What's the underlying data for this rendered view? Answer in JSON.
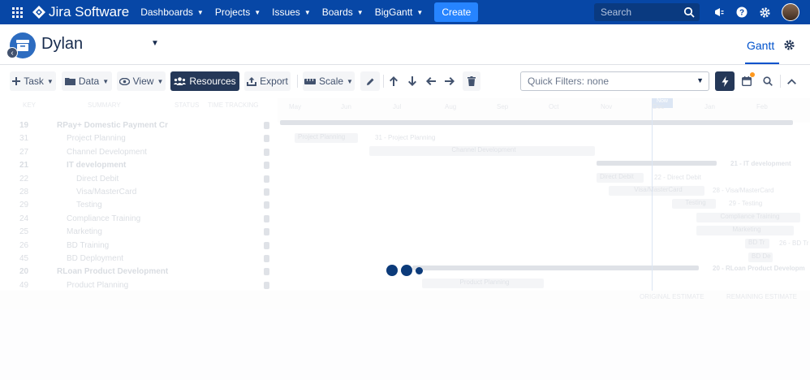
{
  "topnav": {
    "product": "Jira Software",
    "items": [
      {
        "label": "Dashboards"
      },
      {
        "label": "Projects"
      },
      {
        "label": "Issues"
      },
      {
        "label": "Boards"
      },
      {
        "label": "BigGantt"
      }
    ],
    "create_label": "Create",
    "search_placeholder": "Search"
  },
  "project": {
    "name": "Dylan",
    "active_tab": "Gantt"
  },
  "toolbar": {
    "task": "Task",
    "data": "Data",
    "view": "View",
    "resources": "Resources",
    "export": "Export",
    "scale": "Scale",
    "quick_filters": "Quick Filters: none"
  },
  "gantt": {
    "columns": [
      "KEY",
      "SUMMARY",
      "STATUS",
      "TIME TRACKING"
    ],
    "rows": [
      {
        "key": "19",
        "name": "RPay+ Domestic Payment Cr",
        "level": 0,
        "group": true
      },
      {
        "key": "31",
        "name": "Project Planning",
        "level": 1,
        "group": false
      },
      {
        "key": "27",
        "name": "Channel Development",
        "level": 1,
        "group": false
      },
      {
        "key": "21",
        "name": "IT development",
        "level": 1,
        "group": true
      },
      {
        "key": "22",
        "name": "Direct Debit",
        "level": 2,
        "group": false
      },
      {
        "key": "28",
        "name": "Visa/MasterCard",
        "level": 2,
        "group": false
      },
      {
        "key": "29",
        "name": "Testing",
        "level": 2,
        "group": false
      },
      {
        "key": "24",
        "name": "Compliance Training",
        "level": 1,
        "group": false
      },
      {
        "key": "25",
        "name": "Marketing",
        "level": 1,
        "group": false
      },
      {
        "key": "26",
        "name": "BD Training",
        "level": 1,
        "group": false
      },
      {
        "key": "45",
        "name": "BD Deployment",
        "level": 1,
        "group": false
      },
      {
        "key": "20",
        "name": "RLoan Product Development",
        "level": 0,
        "group": true
      },
      {
        "key": "49",
        "name": "Product Planning",
        "level": 1,
        "group": false
      }
    ],
    "timeline_months": [
      "May",
      "Jun",
      "Jul",
      "Aug",
      "Sep",
      "Oct",
      "Nov",
      "Dec",
      "Jan",
      "Feb"
    ],
    "today_label": "Now",
    "bar_labels": {
      "project_planning": "Project Planning",
      "project_planning_side": "31 - Project Planning",
      "channel_dev": "Channel Development",
      "it_dev_side": "21 - IT development",
      "direct_debit": "Direct Debit",
      "direct_debit_side": "22 - Direct Debit",
      "visa": "Visa/MasterCard",
      "visa_side": "28 - Visa/MasterCard",
      "testing": "Testing",
      "testing_side": "29 - Testing",
      "compliance": "Compliance Training",
      "marketing": "Marketing",
      "bd_training": "BD Tr",
      "bd_training_side": "26 - BD Tr",
      "bd_deploy": "BD De",
      "rloan_side": "20 - RLoan Product Developm",
      "product_planning": "Product Planning"
    },
    "legend": {
      "original": "ORIGINAL ESTIMATE",
      "remaining": "REMAINING ESTIMATE"
    }
  },
  "colors": {
    "nav_bg": "#0747a6",
    "create_bg": "#2684ff",
    "dark_button": "#253858",
    "accent": "#0052cc",
    "loader": "#0c3b7a"
  },
  "icons": [
    "apps-grid-icon",
    "jira-logo-icon",
    "search-icon",
    "megaphone-icon",
    "help-icon",
    "settings-icon",
    "project-icon",
    "back-icon",
    "gear-icon",
    "plus-icon",
    "folder-icon",
    "eye-icon",
    "users-icon",
    "export-icon",
    "ruler-icon",
    "pencil-icon",
    "arrow-up-icon",
    "arrow-down-icon",
    "arrow-left-icon",
    "arrow-right-icon",
    "trash-icon",
    "lightning-icon",
    "calendar-icon",
    "magnifier-icon",
    "chevron-up-icon"
  ]
}
